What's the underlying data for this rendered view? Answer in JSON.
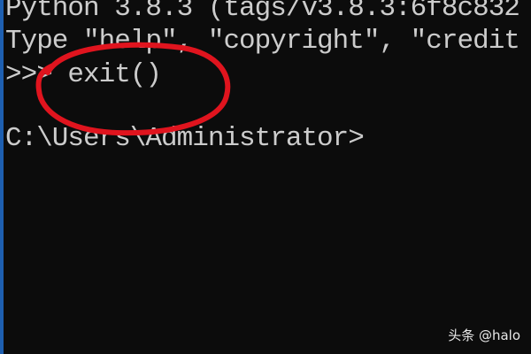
{
  "console": {
    "lines": [
      "Python 3.8.3 (tags/v3.8.3:6f8c832",
      "Type \"help\", \"copyright\", \"credit",
      ">>> exit()",
      "C:\\Users\\Administrator>"
    ]
  },
  "overlay": {
    "watermark": "头条 @halo"
  },
  "colors": {
    "background": "#0c0c0c",
    "text": "#cccccc",
    "annotation": "#e0141e",
    "edge": "#1e5fb0"
  }
}
